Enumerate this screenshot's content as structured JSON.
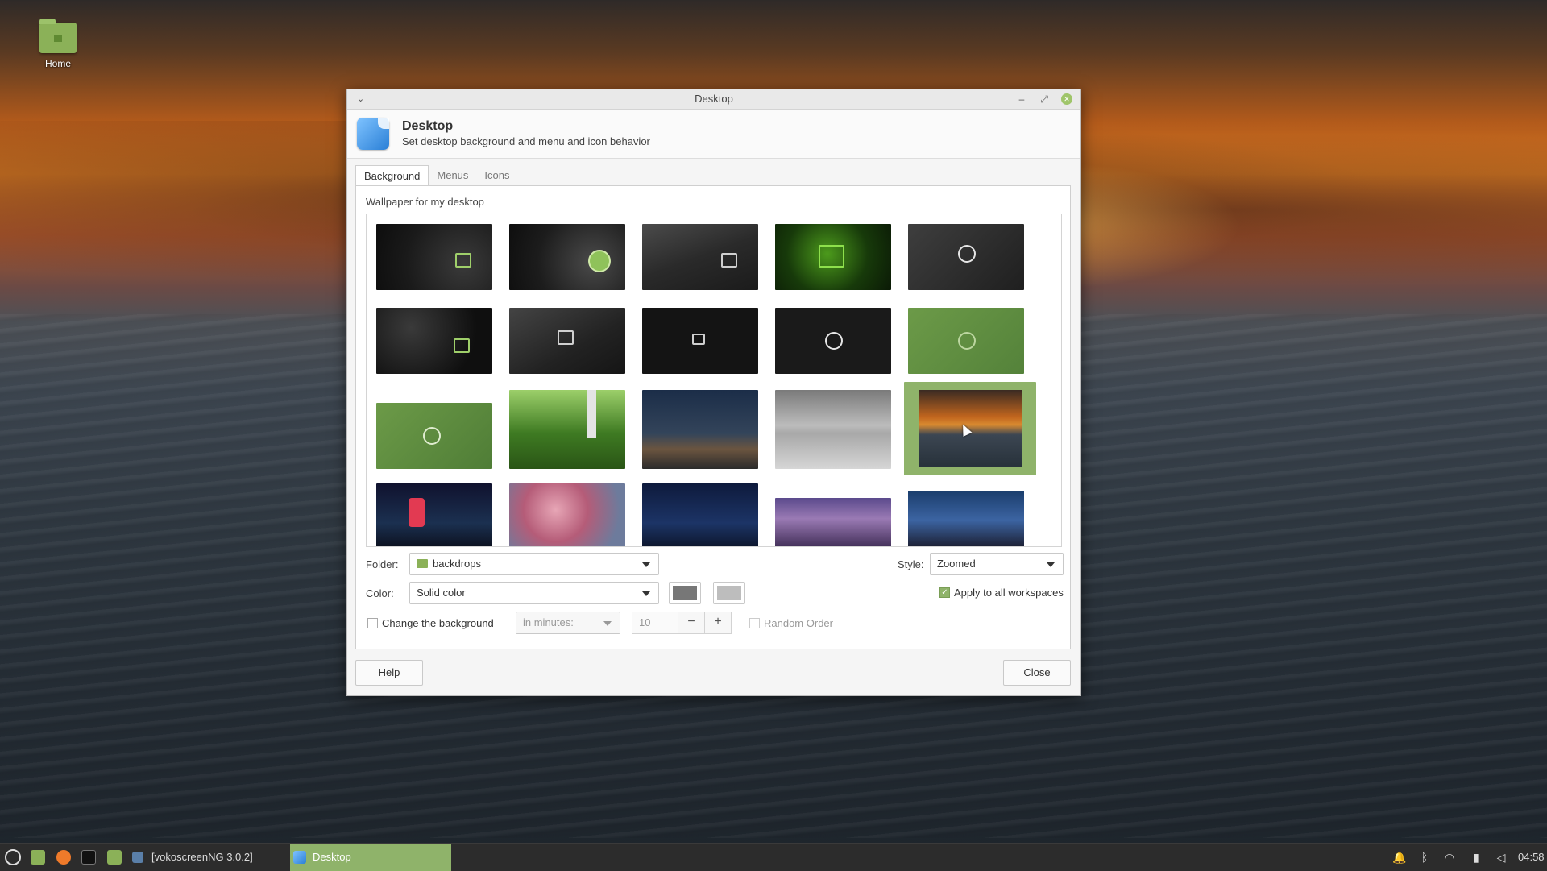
{
  "desktop": {
    "home_label": "Home"
  },
  "window": {
    "title": "Desktop",
    "header_title": "Desktop",
    "header_subtitle": "Set desktop background and menu and icon behavior",
    "tabs": [
      {
        "label": "Background",
        "active": true
      },
      {
        "label": "Menus",
        "active": false
      },
      {
        "label": "Icons",
        "active": false
      }
    ],
    "wallpaper_label": "Wallpaper for my desktop",
    "folder_label": "Folder:",
    "folder_value": "backdrops",
    "style_label": "Style:",
    "style_value": "Zoomed",
    "color_label": "Color:",
    "color_value": "Solid color",
    "color1": "#777777",
    "color2": "#bdbdbd",
    "apply_all_label": "Apply to all workspaces",
    "apply_all_checked": true,
    "change_bg_label": "Change the background",
    "change_bg_checked": false,
    "interval_placeholder": "in minutes:",
    "interval_value": "10",
    "minus": "−",
    "plus": "+",
    "random_label": "Random Order",
    "help_label": "Help",
    "close_label": "Close",
    "selected_wallpaper_index": 14
  },
  "taskbar": {
    "items": [
      {
        "label": "[vokoscreenNG 3.0.2]"
      },
      {
        "label": "Desktop",
        "active": true
      }
    ],
    "clock": "04:58",
    "accent": "#8fb36a"
  }
}
